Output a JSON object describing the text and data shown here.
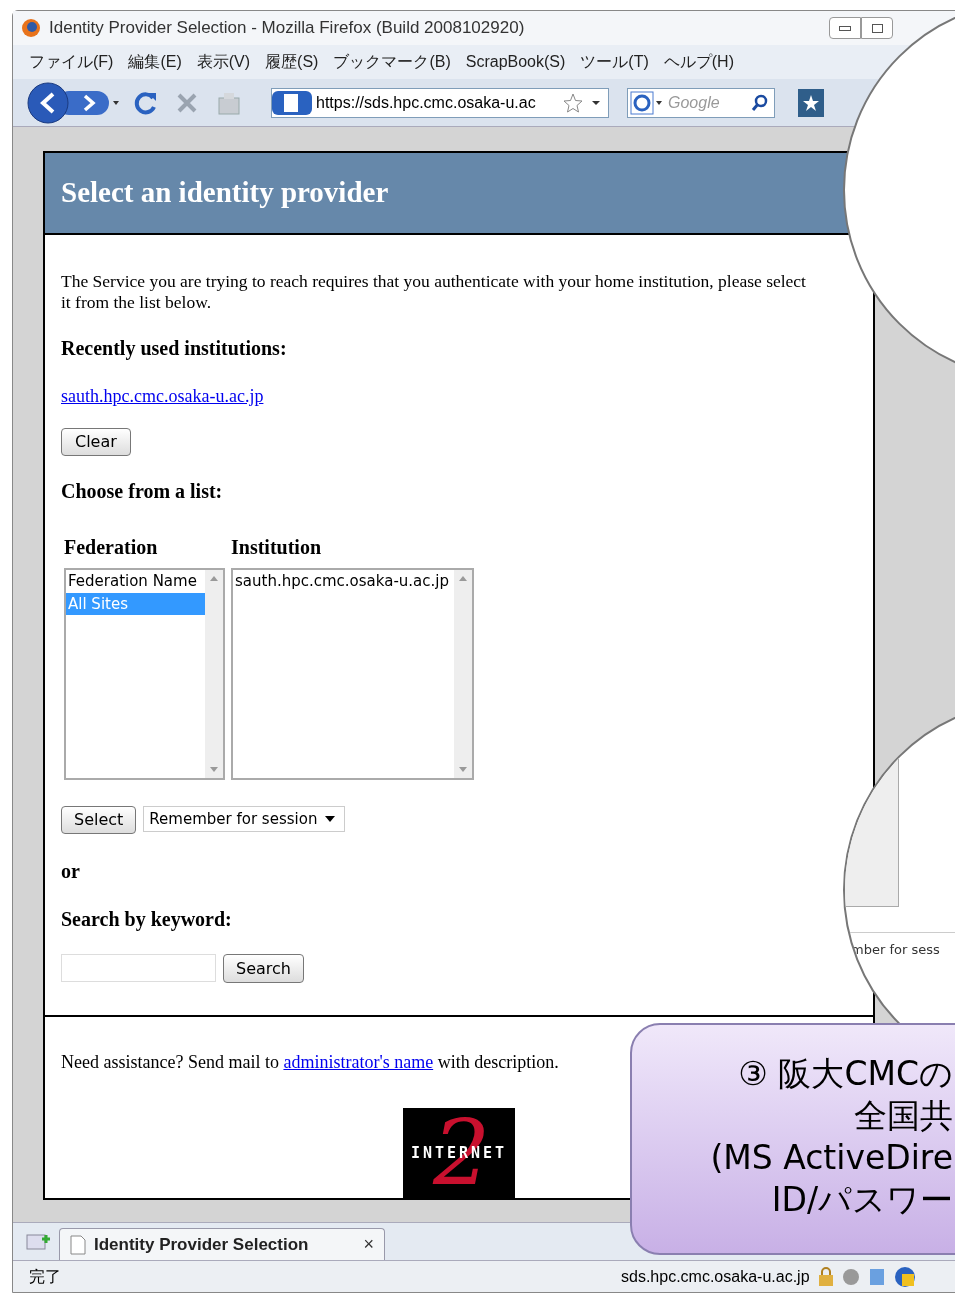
{
  "window": {
    "title": "Identity Provider Selection - Mozilla Firefox (Build 2008102920)"
  },
  "menu": [
    "ファイル(F)",
    "編集(E)",
    "表示(V)",
    "履歴(S)",
    "ブックマーク(B)",
    "ScrapBook(S)",
    "ツール(T)",
    "ヘルプ(H)"
  ],
  "toolbar": {
    "url": "https://sds.hpc.cmc.osaka-u.ac",
    "search_placeholder": "Google"
  },
  "page": {
    "heading": "Select an identity provider",
    "intro": "The Service you are trying to reach requires that you authenticate with your home institution, please select it from the list below.",
    "recent_heading": "Recently used institutions:",
    "recent_link": "sauth.hpc.cmc.osaka-u.ac.jp",
    "clear_button": "Clear",
    "choose_heading": "Choose from a list:",
    "federation": {
      "label": "Federation",
      "options": [
        {
          "text": "Federation Name",
          "selected": false
        },
        {
          "text": "All Sites",
          "selected": true
        }
      ]
    },
    "institution": {
      "label": "Institution",
      "options": [
        {
          "text": "sauth.hpc.cmc.osaka-u.ac.jp",
          "selected": false
        }
      ]
    },
    "select_button": "Select",
    "remember": "Remember for session",
    "or": "or",
    "search_heading": "Search by keyword:",
    "search_button": "Search",
    "assistance_before": "Need assistance? Send mail to",
    "assistance_link": "administrator's name",
    "assistance_after": "with description.",
    "logo": {
      "word": "INTERNET",
      "numeral": "2"
    }
  },
  "tab": {
    "title": "Identity Provider Selection",
    "close": "×"
  },
  "status": {
    "text": "完了",
    "host": "sds.hpc.cmc.osaka-u.ac.jp"
  },
  "magnifier": {
    "fragment": "mber for sess"
  },
  "callout": {
    "lines": [
      "③ 阪大CMCの",
      "全国共",
      "(MS ActiveDire",
      "ID/パスワー"
    ]
  }
}
